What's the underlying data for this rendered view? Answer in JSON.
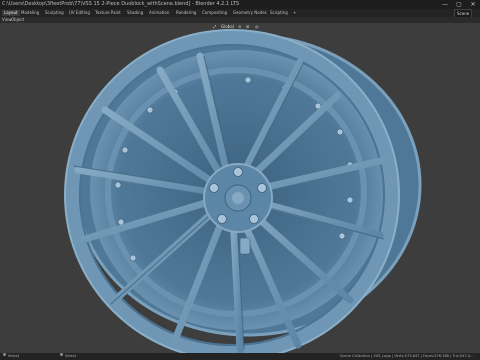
{
  "window": {
    "title": "C:\\Users\\Desktop\\3fleetProb\\77\\VSS 15 2-Piece Duoblock_withScene.blend] - Blender 4.2.1 LTS",
    "minimize_glyph": "—",
    "maximize_glyph": "▢",
    "close_glyph": "✕"
  },
  "menubar": {
    "tabs": [
      "Layout",
      "Modeling",
      "Sculpting",
      "UV Editing",
      "Texture Paint",
      "Shading",
      "Animation",
      "Rendering",
      "Compositing",
      "Geometry Nodes",
      "Scripting"
    ],
    "active_tab": "Layout",
    "add_tab_glyph": "+",
    "scene_label": "Scene"
  },
  "header": {
    "items": [
      "View",
      "Object"
    ]
  },
  "viewport": {
    "orientation_label": "Global",
    "background_color": "#3d3d3d",
    "wheel_color": "#5b86a6",
    "wheel_shadow": "#3d6280",
    "wheel_highlight": "#86aac4"
  },
  "statusbar": {
    "left_label": "Select",
    "middle_label": "Select",
    "right_text": "Scene Collection | VSS_Logo | Verts:573,647 | Faces:576,386 | Tris:547,4..."
  }
}
